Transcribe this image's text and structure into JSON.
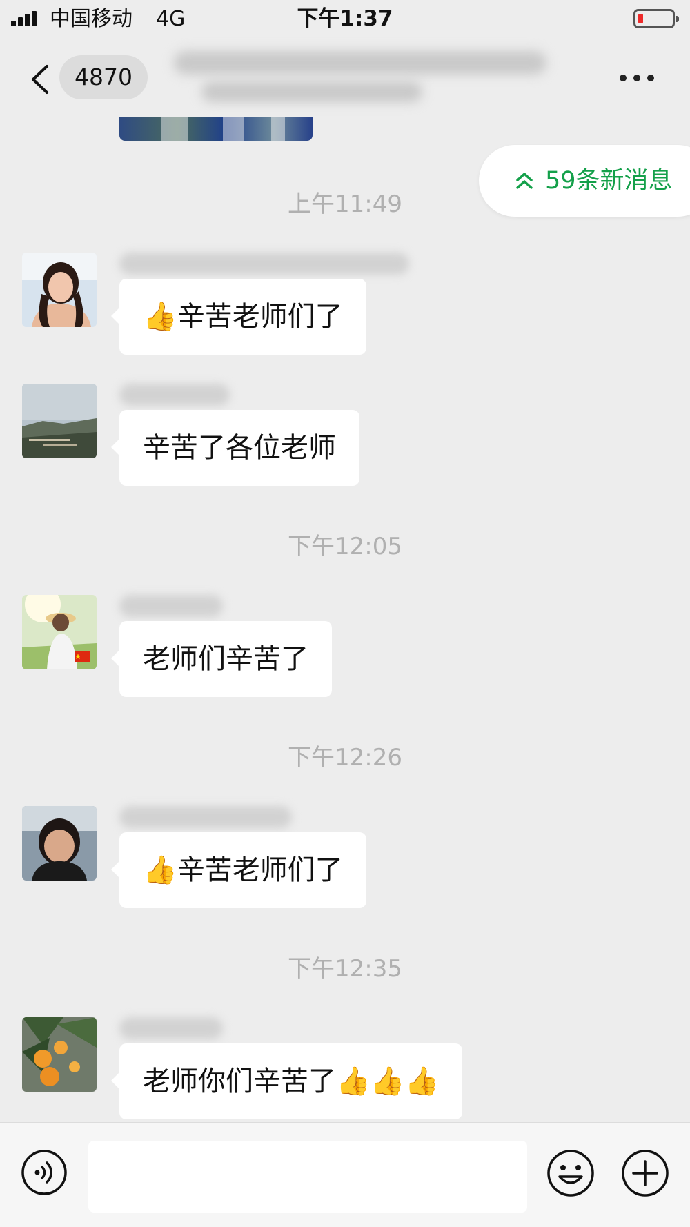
{
  "status_bar": {
    "carrier": "中国移动",
    "network": "4G",
    "time": "下午1:37",
    "battery_level_fraction": 0.15,
    "battery_color": "#ee2a2a"
  },
  "nav": {
    "unread_count": "4870",
    "back_icon": "chevron-left-icon",
    "more_icon": "more-dots-icon"
  },
  "new_messages": {
    "label": "59条新消息",
    "icon": "double-chevron-up-icon",
    "color": "#14a04a"
  },
  "messages": [
    {
      "time": "上午11:49",
      "text": "辛苦老师们了",
      "emoji_before": "👍",
      "emoji_after": ""
    },
    {
      "time": "",
      "text": "辛苦了各位老师",
      "emoji_before": "",
      "emoji_after": ""
    },
    {
      "time": "下午12:05",
      "text": "老师们辛苦了",
      "emoji_before": "",
      "emoji_after": ""
    },
    {
      "time": "下午12:26",
      "text": "辛苦老师们了",
      "emoji_before": "👍",
      "emoji_after": ""
    },
    {
      "time": "下午12:35",
      "text": "老师你们辛苦了",
      "emoji_before": "",
      "emoji_after": "👍👍👍"
    }
  ],
  "input_bar": {
    "voice_icon": "voice-icon",
    "emoji_icon": "emoji-smile-icon",
    "plus_icon": "plus-circle-icon",
    "input_value": ""
  }
}
